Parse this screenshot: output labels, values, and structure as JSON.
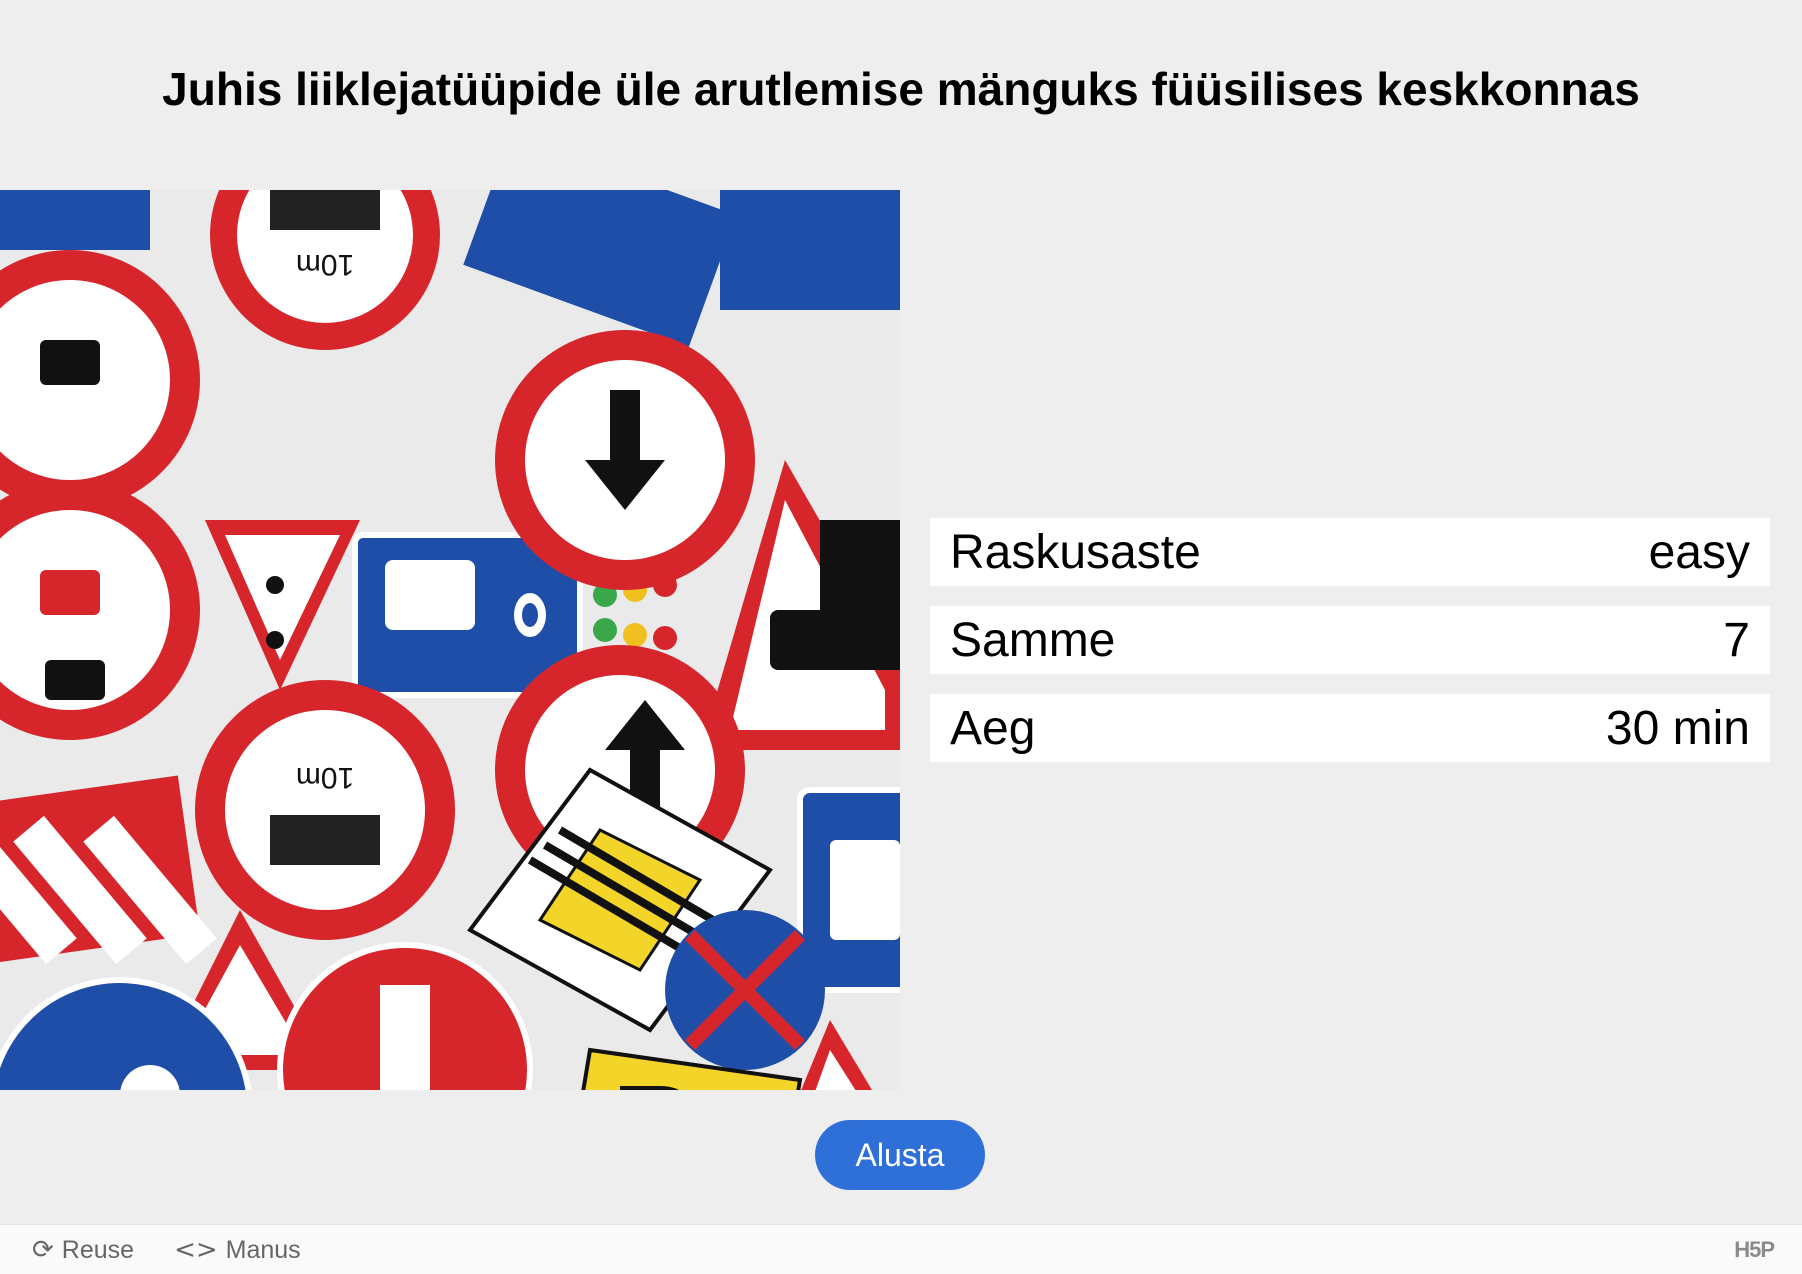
{
  "title": "Juhis liiklejatüüpide üle arutlemise mänguks füüsilises keskkonnas",
  "hero_image": {
    "description_icon": "traffic-signs-collage",
    "sign_texts": [
      "10m",
      "10m"
    ]
  },
  "info": [
    {
      "label": "Raskusaste",
      "value": "easy"
    },
    {
      "label": "Samme",
      "value": "7"
    },
    {
      "label": "Aeg",
      "value": "30 min"
    }
  ],
  "start_button": {
    "label": "Alusta",
    "color": "#2f6fd8"
  },
  "footer": {
    "reuse_label": "Reuse",
    "reuse_icon": "refresh-icon",
    "embed_label": "Manus",
    "embed_icon": "code-icon",
    "logo": "H5P"
  },
  "colors": {
    "background": "#eeeeee",
    "sign_red": "#d7262b",
    "sign_blue": "#1f4ea8",
    "sign_yellow": "#f3d429"
  }
}
